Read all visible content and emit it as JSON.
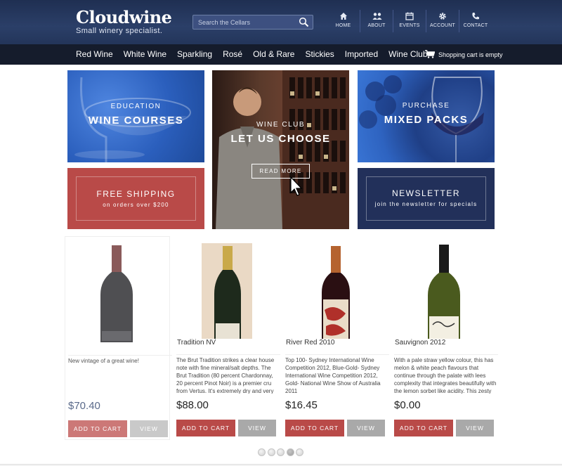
{
  "header": {
    "logo_title": "Cloudwine",
    "logo_tagline": "Small winery specialist.",
    "search_placeholder": "Search the Cellars",
    "top_nav": [
      {
        "label": "HOME",
        "icon": "home-icon"
      },
      {
        "label": "ABOUT",
        "icon": "people-icon"
      },
      {
        "label": "EVENTS",
        "icon": "calendar-icon"
      },
      {
        "label": "ACCOUNT",
        "icon": "gear-icon"
      },
      {
        "label": "CONTACT",
        "icon": "phone-icon"
      }
    ]
  },
  "main_nav": {
    "items": [
      "Red Wine",
      "White Wine",
      "Sparkling",
      "Rosé",
      "Old & Rare",
      "Stickies",
      "Imported",
      "Wine Club"
    ],
    "cart_text": "Shopping cart is empty"
  },
  "tiles": {
    "education": {
      "kicker": "EDUCATION",
      "title": "WINE COURSES"
    },
    "wine_club": {
      "kicker": "WINE CLUB",
      "title": "LET US CHOOSE",
      "button": "READ MORE"
    },
    "mixed": {
      "kicker": "PURCHASE",
      "title": "MIXED PACKS"
    },
    "shipping": {
      "title": "FREE SHIPPING",
      "subtitle": "on orders over $200"
    },
    "newsletter": {
      "title": "NEWSLETTER",
      "subtitle": "join the newsletter for specials"
    }
  },
  "products": [
    {
      "name": "",
      "description": "New vintage of a great wine!",
      "price": "$70.40",
      "add_label": "ADD TO CART",
      "view_label": "VIEW"
    },
    {
      "name": "Tradition NV",
      "description": "The Brut Tradition strikes a clear house note with fine mineral/salt depths. The Brut Tradition (80 percent Chardonnay, 20 percent Pinot Noir) is a premier cru from Vertus. It's extremely dry and very",
      "price": "$88.00",
      "add_label": "ADD TO CART",
      "view_label": "VIEW"
    },
    {
      "name": "River Red 2010",
      "description": "Top 100- Sydney International Wine Competition 2012, Blue-Gold- Sydney International Wine Competition 2012, Gold- National Wine Show of Australia 2011",
      "price": "$16.45",
      "add_label": "ADD TO CART",
      "view_label": "VIEW"
    },
    {
      "name": "Sauvignon 2012",
      "description": "With a pale straw yellow colour, this has melon & white peach flavours that continue through the palate with lees complexity that integrates beautifully with the lemon sorbet like acidity. This zesty",
      "price": "$0.00",
      "add_label": "ADD TO CART",
      "view_label": "VIEW"
    }
  ],
  "pager": {
    "count": 5,
    "active_index": 3
  },
  "colors": {
    "header_bg": "#23355a",
    "nav_bg": "#151c2c",
    "accent_red": "#b94a48",
    "navy_tile": "#22305a",
    "view_grey": "#a9a9a9"
  }
}
